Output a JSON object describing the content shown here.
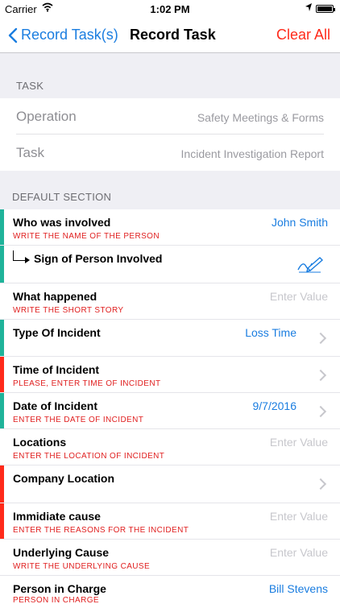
{
  "status": {
    "carrier": "Carrier",
    "time": "1:02 PM"
  },
  "nav": {
    "back_label": "Record Task(s)",
    "title": "Record Task",
    "right_label": "Clear All"
  },
  "task_section": {
    "header": "Task",
    "rows": [
      {
        "label": "Operation",
        "value": "Safety Meetings & Forms"
      },
      {
        "label": "Task",
        "value": "Incident Investigation Report"
      }
    ]
  },
  "default_section": {
    "header": "Default Section",
    "rows": [
      {
        "title": "Who was involved",
        "subtitle": "WRITE THE NAME OF THE PERSON",
        "value": "John Smith",
        "placeholder": "",
        "chevron": false,
        "stripe": "#1fb39a"
      },
      {
        "title": "Sign of Person Involved",
        "subtitle": "",
        "value": "",
        "placeholder": "",
        "chevron": false,
        "stripe": "#1fb39a",
        "icon": "signature-icon"
      },
      {
        "title": "What happened",
        "subtitle": "WRITE THE SHORT STORY",
        "value": "",
        "placeholder": "Enter Value",
        "chevron": false,
        "stripe": ""
      },
      {
        "title": "Type Of Incident",
        "subtitle": "",
        "value": "Loss Time",
        "placeholder": "",
        "chevron": true,
        "stripe": "#1fb39a"
      },
      {
        "title": "Time of Incident",
        "subtitle": "PLEASE, ENTER TIME OF INCIDENT",
        "value": "",
        "placeholder": "",
        "chevron": true,
        "stripe": "#ff2a1a"
      },
      {
        "title": "Date of Incident",
        "subtitle": "ENTER THE DATE OF INCIDENT",
        "value": "9/7/2016",
        "placeholder": "",
        "chevron": true,
        "stripe": "#1fb39a"
      },
      {
        "title": "Locations",
        "subtitle": "ENTER THE LOCATION OF INCIDENT",
        "value": "",
        "placeholder": "Enter Value",
        "chevron": false,
        "stripe": ""
      },
      {
        "title": "Company Location",
        "subtitle": "",
        "value": "",
        "placeholder": "",
        "chevron": true,
        "stripe": "#ff2a1a"
      },
      {
        "title": "Immidiate cause",
        "subtitle": "ENTER THE REASONS FOR THE INCIDENT",
        "value": "",
        "placeholder": "Enter Value",
        "chevron": false,
        "stripe": "#ff2a1a"
      },
      {
        "title": "Underlying Cause",
        "subtitle": "WRITE THE UNDERLYING CAUSE",
        "value": "",
        "placeholder": "Enter Value",
        "chevron": false,
        "stripe": ""
      },
      {
        "title": "Person in Charge",
        "subtitle": "PERSON IN CHARGE",
        "value": "Bill Stevens",
        "placeholder": "",
        "chevron": false,
        "stripe": ""
      }
    ]
  },
  "colors": {
    "accent": "#1a7de0",
    "destructive": "#ff2a1a",
    "valid_stripe": "#1fb39a",
    "required_stripe": "#ff2a1a"
  }
}
